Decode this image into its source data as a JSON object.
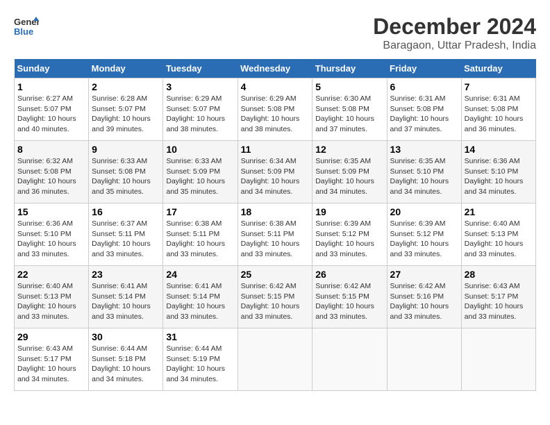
{
  "header": {
    "logo_line1": "General",
    "logo_line2": "Blue",
    "month": "December 2024",
    "location": "Baragaon, Uttar Pradesh, India"
  },
  "weekdays": [
    "Sunday",
    "Monday",
    "Tuesday",
    "Wednesday",
    "Thursday",
    "Friday",
    "Saturday"
  ],
  "weeks": [
    [
      {
        "day": "1",
        "sunrise": "6:27 AM",
        "sunset": "5:07 PM",
        "daylight": "10 hours and 40 minutes."
      },
      {
        "day": "2",
        "sunrise": "6:28 AM",
        "sunset": "5:07 PM",
        "daylight": "10 hours and 39 minutes."
      },
      {
        "day": "3",
        "sunrise": "6:29 AM",
        "sunset": "5:07 PM",
        "daylight": "10 hours and 38 minutes."
      },
      {
        "day": "4",
        "sunrise": "6:29 AM",
        "sunset": "5:08 PM",
        "daylight": "10 hours and 38 minutes."
      },
      {
        "day": "5",
        "sunrise": "6:30 AM",
        "sunset": "5:08 PM",
        "daylight": "10 hours and 37 minutes."
      },
      {
        "day": "6",
        "sunrise": "6:31 AM",
        "sunset": "5:08 PM",
        "daylight": "10 hours and 37 minutes."
      },
      {
        "day": "7",
        "sunrise": "6:31 AM",
        "sunset": "5:08 PM",
        "daylight": "10 hours and 36 minutes."
      }
    ],
    [
      {
        "day": "8",
        "sunrise": "6:32 AM",
        "sunset": "5:08 PM",
        "daylight": "10 hours and 36 minutes."
      },
      {
        "day": "9",
        "sunrise": "6:33 AM",
        "sunset": "5:08 PM",
        "daylight": "10 hours and 35 minutes."
      },
      {
        "day": "10",
        "sunrise": "6:33 AM",
        "sunset": "5:09 PM",
        "daylight": "10 hours and 35 minutes."
      },
      {
        "day": "11",
        "sunrise": "6:34 AM",
        "sunset": "5:09 PM",
        "daylight": "10 hours and 34 minutes."
      },
      {
        "day": "12",
        "sunrise": "6:35 AM",
        "sunset": "5:09 PM",
        "daylight": "10 hours and 34 minutes."
      },
      {
        "day": "13",
        "sunrise": "6:35 AM",
        "sunset": "5:10 PM",
        "daylight": "10 hours and 34 minutes."
      },
      {
        "day": "14",
        "sunrise": "6:36 AM",
        "sunset": "5:10 PM",
        "daylight": "10 hours and 34 minutes."
      }
    ],
    [
      {
        "day": "15",
        "sunrise": "6:36 AM",
        "sunset": "5:10 PM",
        "daylight": "10 hours and 33 minutes."
      },
      {
        "day": "16",
        "sunrise": "6:37 AM",
        "sunset": "5:11 PM",
        "daylight": "10 hours and 33 minutes."
      },
      {
        "day": "17",
        "sunrise": "6:38 AM",
        "sunset": "5:11 PM",
        "daylight": "10 hours and 33 minutes."
      },
      {
        "day": "18",
        "sunrise": "6:38 AM",
        "sunset": "5:11 PM",
        "daylight": "10 hours and 33 minutes."
      },
      {
        "day": "19",
        "sunrise": "6:39 AM",
        "sunset": "5:12 PM",
        "daylight": "10 hours and 33 minutes."
      },
      {
        "day": "20",
        "sunrise": "6:39 AM",
        "sunset": "5:12 PM",
        "daylight": "10 hours and 33 minutes."
      },
      {
        "day": "21",
        "sunrise": "6:40 AM",
        "sunset": "5:13 PM",
        "daylight": "10 hours and 33 minutes."
      }
    ],
    [
      {
        "day": "22",
        "sunrise": "6:40 AM",
        "sunset": "5:13 PM",
        "daylight": "10 hours and 33 minutes."
      },
      {
        "day": "23",
        "sunrise": "6:41 AM",
        "sunset": "5:14 PM",
        "daylight": "10 hours and 33 minutes."
      },
      {
        "day": "24",
        "sunrise": "6:41 AM",
        "sunset": "5:14 PM",
        "daylight": "10 hours and 33 minutes."
      },
      {
        "day": "25",
        "sunrise": "6:42 AM",
        "sunset": "5:15 PM",
        "daylight": "10 hours and 33 minutes."
      },
      {
        "day": "26",
        "sunrise": "6:42 AM",
        "sunset": "5:15 PM",
        "daylight": "10 hours and 33 minutes."
      },
      {
        "day": "27",
        "sunrise": "6:42 AM",
        "sunset": "5:16 PM",
        "daylight": "10 hours and 33 minutes."
      },
      {
        "day": "28",
        "sunrise": "6:43 AM",
        "sunset": "5:17 PM",
        "daylight": "10 hours and 33 minutes."
      }
    ],
    [
      {
        "day": "29",
        "sunrise": "6:43 AM",
        "sunset": "5:17 PM",
        "daylight": "10 hours and 34 minutes."
      },
      {
        "day": "30",
        "sunrise": "6:44 AM",
        "sunset": "5:18 PM",
        "daylight": "10 hours and 34 minutes."
      },
      {
        "day": "31",
        "sunrise": "6:44 AM",
        "sunset": "5:19 PM",
        "daylight": "10 hours and 34 minutes."
      },
      null,
      null,
      null,
      null
    ]
  ],
  "labels": {
    "sunrise": "Sunrise:",
    "sunset": "Sunset:",
    "daylight": "Daylight:"
  }
}
